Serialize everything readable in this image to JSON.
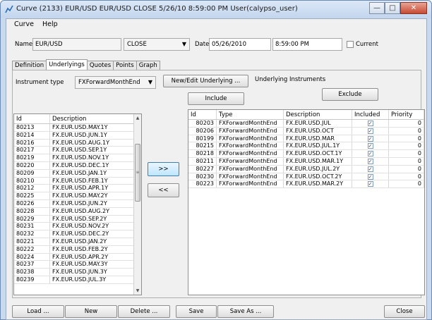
{
  "window": {
    "title": "Curve (2133) EUR/USD EUR/USD CLOSE 5/26/10 8:59:00 PM User(calypso_user)",
    "minimize": "—",
    "maximize": "□",
    "close": "✕"
  },
  "menu": [
    "Curve",
    "Help"
  ],
  "header": {
    "name_label": "Name",
    "name_value": "EUR/USD",
    "type_value": "CLOSE",
    "date_label": "Date",
    "date_value": "05/26/2010",
    "time_value": "8:59:00 PM",
    "current_label": "Current"
  },
  "tabs": [
    "Definition",
    "Underlyings",
    "Quotes",
    "Points",
    "Graph"
  ],
  "active_tab": "Underlyings",
  "underlyings": {
    "instrument_type_label": "Instrument type",
    "instrument_type_value": "FXForwardMonthEnd",
    "new_edit_button": "New/Edit Underlying ...",
    "underlying_instruments_label": "Underlying Instruments",
    "include_button": "Include",
    "exclude_button": "Exclude",
    "move_right_button": ">>",
    "move_left_button": "<<"
  },
  "left_table": {
    "columns": [
      "Id",
      "Description"
    ],
    "rows": [
      [
        "80213",
        "FX.EUR.USD.MAY.1Y"
      ],
      [
        "80214",
        "FX.EUR.USD.JUN.1Y"
      ],
      [
        "80216",
        "FX.EUR.USD.AUG.1Y"
      ],
      [
        "80217",
        "FX.EUR.USD.SEP.1Y"
      ],
      [
        "80219",
        "FX.EUR.USD.NOV.1Y"
      ],
      [
        "80220",
        "FX.EUR.USD.DEC.1Y"
      ],
      [
        "80209",
        "FX.EUR.USD.JAN.1Y"
      ],
      [
        "80210",
        "FX.EUR.USD.FEB.1Y"
      ],
      [
        "80212",
        "FX.EUR.USD.APR.1Y"
      ],
      [
        "80225",
        "FX.EUR.USD.MAY.2Y"
      ],
      [
        "80226",
        "FX.EUR.USD.JUN.2Y"
      ],
      [
        "80228",
        "FX.EUR.USD.AUG.2Y"
      ],
      [
        "80229",
        "FX.EUR.USD.SEP.2Y"
      ],
      [
        "80231",
        "FX.EUR.USD.NOV.2Y"
      ],
      [
        "80232",
        "FX.EUR.USD.DEC.2Y"
      ],
      [
        "80221",
        "FX.EUR.USD.JAN.2Y"
      ],
      [
        "80222",
        "FX.EUR.USD.FEB.2Y"
      ],
      [
        "80224",
        "FX.EUR.USD.APR.2Y"
      ],
      [
        "80237",
        "FX.EUR.USD.MAY.3Y"
      ],
      [
        "80238",
        "FX.EUR.USD.JUN.3Y"
      ],
      [
        "80239",
        "FX.EUR.USD.JUL.3Y"
      ]
    ]
  },
  "right_table": {
    "columns": [
      "Id",
      "Type",
      "Description",
      "Included",
      "Priority"
    ],
    "rows": [
      [
        "80203",
        "FXForwardMonthEnd",
        "FX.EUR.USD.JUL",
        "✓",
        "0"
      ],
      [
        "80206",
        "FXForwardMonthEnd",
        "FX.EUR.USD.OCT",
        "✓",
        "0"
      ],
      [
        "80199",
        "FXForwardMonthEnd",
        "FX.EUR.USD.MAR",
        "✓",
        "0"
      ],
      [
        "80215",
        "FXForwardMonthEnd",
        "FX.EUR.USD.JUL.1Y",
        "✓",
        "0"
      ],
      [
        "80218",
        "FXForwardMonthEnd",
        "FX.EUR.USD.OCT.1Y",
        "✓",
        "0"
      ],
      [
        "80211",
        "FXForwardMonthEnd",
        "FX.EUR.USD.MAR.1Y",
        "✓",
        "0"
      ],
      [
        "80227",
        "FXForwardMonthEnd",
        "FX.EUR.USD.JUL.2Y",
        "✓",
        "0"
      ],
      [
        "80230",
        "FXForwardMonthEnd",
        "FX.EUR.USD.OCT.2Y",
        "✓",
        "0"
      ],
      [
        "80223",
        "FXForwardMonthEnd",
        "FX.EUR.USD.MAR.2Y",
        "✓",
        "0"
      ]
    ]
  },
  "footer": {
    "load": "Load ...",
    "new": "New",
    "delete": "Delete ...",
    "save": "Save",
    "save_as": "Save As ...",
    "close": "Close"
  },
  "icons": {
    "app": "curve-icon",
    "scroll_up": "▲",
    "scroll_down": "▼",
    "scroll_grip": "≡",
    "dropdown": "▼"
  }
}
